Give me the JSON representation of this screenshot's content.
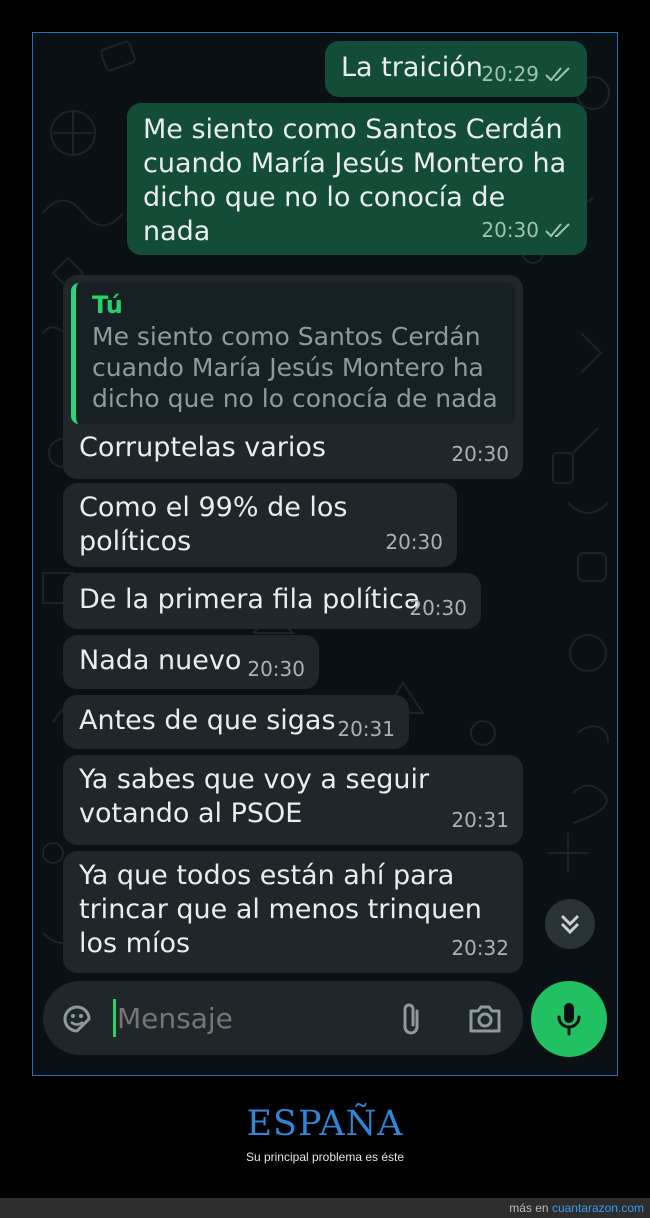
{
  "chat": {
    "messages": [
      {
        "direction": "out",
        "text": "La traición",
        "time": "20:29",
        "read": true
      },
      {
        "direction": "out",
        "text": "Me siento como Santos Cerdán cuando María Jesús Montero ha dicho que no lo conocía de nada",
        "time": "20:30",
        "read": true
      },
      {
        "direction": "in",
        "quote_author": "Tú",
        "quote_text": "Me siento como Santos Cerdán cuando María Jesús Montero ha dicho que no lo conocía de nada",
        "text": "Corruptelas varios",
        "time": "20:30"
      },
      {
        "direction": "in",
        "text": "Como el 99% de los políticos",
        "time": "20:30"
      },
      {
        "direction": "in",
        "text": "De la primera fila política",
        "time": "20:30"
      },
      {
        "direction": "in",
        "text": "Nada nuevo",
        "time": "20:30"
      },
      {
        "direction": "in",
        "text": "Antes de que sigas",
        "time": "20:31"
      },
      {
        "direction": "in",
        "text": "Ya sabes que voy a seguir votando al PSOE",
        "time": "20:31"
      },
      {
        "direction": "in",
        "text": "Ya que todos están ahí para trincar que al menos trinquen los míos",
        "time": "20:32"
      }
    ]
  },
  "input": {
    "placeholder": "Mensaje"
  },
  "icons": {
    "sticker": "sticker-icon",
    "attach": "paperclip-icon",
    "camera": "camera-icon",
    "mic": "microphone-icon",
    "scroll": "double-chevron-down-icon",
    "read": "double-check-icon"
  },
  "colors": {
    "outgoing_bubble": "#134d37",
    "incoming_bubble": "#1f272a",
    "quote_accent": "#25d366",
    "mic_button": "#21c063",
    "caption_title": "#2f86d8",
    "footer_link": "#3d9be9"
  },
  "caption": {
    "title": "ESPAÑA",
    "subtitle": "Su principal problema es éste"
  },
  "footer": {
    "prefix": "más en",
    "site": "cuantarazon.com"
  }
}
